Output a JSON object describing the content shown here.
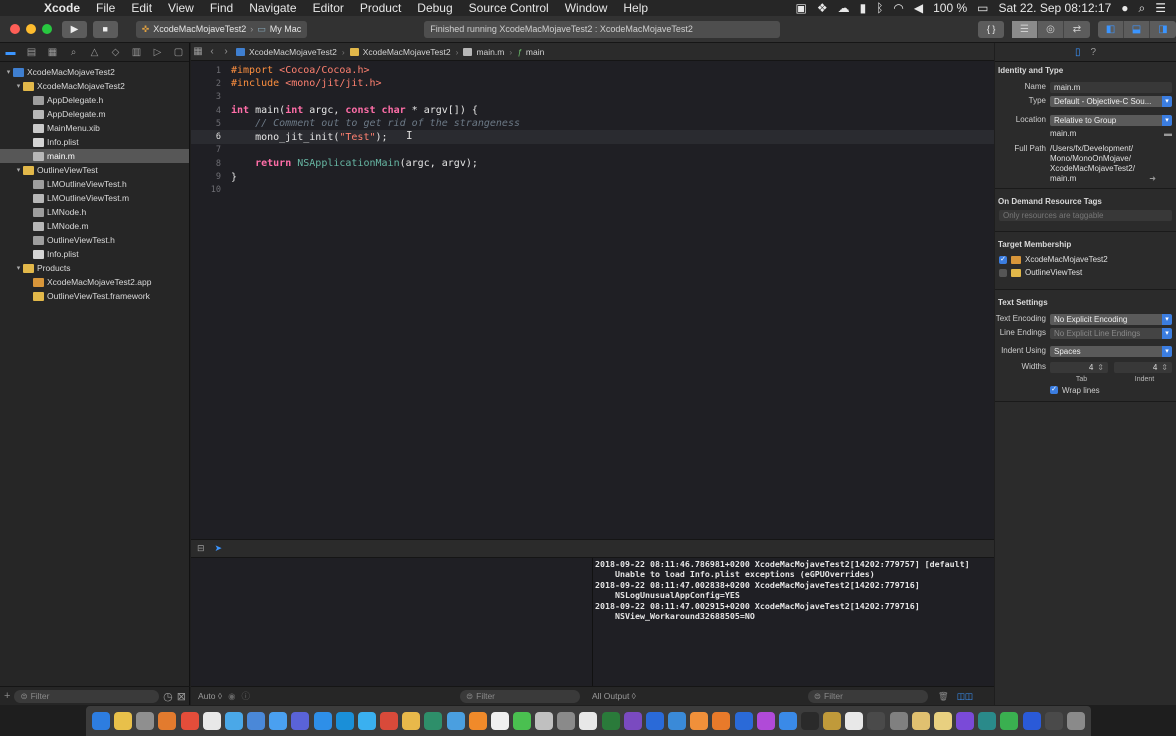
{
  "menubar": {
    "app_name": "Xcode",
    "menus": [
      "File",
      "Edit",
      "View",
      "Find",
      "Navigate",
      "Editor",
      "Product",
      "Debug",
      "Source Control",
      "Window",
      "Help"
    ],
    "battery": "100 %",
    "clock": "Sat 22. Sep  08:12:17"
  },
  "toolbar": {
    "scheme": "XcodeMacMojaveTest2",
    "destination": "My Mac",
    "activity": "Finished running XcodeMacMojaveTest2 : XcodeMacMojaveTest2",
    "code_review_label": "{ }"
  },
  "navigator": {
    "items": [
      {
        "label": "XcodeMacMojaveTest2",
        "depth": 0,
        "kind": "proj",
        "disclosure": "▾",
        "selected": false
      },
      {
        "label": "XcodeMacMojaveTest2",
        "depth": 1,
        "kind": "folder",
        "disclosure": "▾",
        "selected": false
      },
      {
        "label": "AppDelegate.h",
        "depth": 2,
        "kind": "h",
        "disclosure": "",
        "selected": false
      },
      {
        "label": "AppDelegate.m",
        "depth": 2,
        "kind": "m",
        "disclosure": "",
        "selected": false
      },
      {
        "label": "MainMenu.xib",
        "depth": 2,
        "kind": "xib",
        "disclosure": "",
        "selected": false
      },
      {
        "label": "Info.plist",
        "depth": 2,
        "kind": "plist",
        "disclosure": "",
        "selected": false
      },
      {
        "label": "main.m",
        "depth": 2,
        "kind": "m",
        "disclosure": "",
        "selected": true
      },
      {
        "label": "OutlineViewTest",
        "depth": 1,
        "kind": "folder",
        "disclosure": "▾",
        "selected": false
      },
      {
        "label": "LMOutlineViewTest.h",
        "depth": 2,
        "kind": "h",
        "disclosure": "",
        "selected": false
      },
      {
        "label": "LMOutlineViewTest.m",
        "depth": 2,
        "kind": "m",
        "disclosure": "",
        "selected": false
      },
      {
        "label": "LMNode.h",
        "depth": 2,
        "kind": "h",
        "disclosure": "",
        "selected": false
      },
      {
        "label": "LMNode.m",
        "depth": 2,
        "kind": "m",
        "disclosure": "",
        "selected": false
      },
      {
        "label": "OutlineViewTest.h",
        "depth": 2,
        "kind": "h",
        "disclosure": "",
        "selected": false
      },
      {
        "label": "Info.plist",
        "depth": 2,
        "kind": "plist",
        "disclosure": "",
        "selected": false
      },
      {
        "label": "Products",
        "depth": 1,
        "kind": "folder",
        "disclosure": "▾",
        "selected": false
      },
      {
        "label": "XcodeMacMojaveTest2.app",
        "depth": 2,
        "kind": "app",
        "disclosure": "",
        "selected": false
      },
      {
        "label": "OutlineViewTest.framework",
        "depth": 2,
        "kind": "fw",
        "disclosure": "",
        "selected": false
      }
    ],
    "filter_placeholder": "Filter"
  },
  "jumpbar": {
    "crumbs": [
      "XcodeMacMojaveTest2",
      "XcodeMacMojaveTest2",
      "main.m",
      "main"
    ]
  },
  "editor": {
    "current_line": 6,
    "lines": [
      [
        {
          "t": "#import ",
          "c": "pp"
        },
        {
          "t": "<Cocoa/Cocoa.h>",
          "c": "inc"
        }
      ],
      [
        {
          "t": "#include ",
          "c": "pp"
        },
        {
          "t": "<mono/jit/jit.h>",
          "c": "inc"
        }
      ],
      [],
      [
        {
          "t": "int",
          "c": "kw"
        },
        {
          "t": " main(",
          "c": ""
        },
        {
          "t": "int",
          "c": "kw"
        },
        {
          "t": " argc, ",
          "c": ""
        },
        {
          "t": "const",
          "c": "kw"
        },
        {
          "t": " ",
          "c": ""
        },
        {
          "t": "char",
          "c": "kw"
        },
        {
          "t": " * argv[]) {",
          "c": ""
        }
      ],
      [
        {
          "t": "    // Comment out to get rid of the strangeness",
          "c": "cm"
        }
      ],
      [
        {
          "t": "    mono_jit_init(",
          "c": ""
        },
        {
          "t": "\"Test\"",
          "c": "str"
        },
        {
          "t": ");",
          "c": ""
        }
      ],
      [],
      [
        {
          "t": "    ",
          "c": ""
        },
        {
          "t": "return",
          "c": "kw"
        },
        {
          "t": " ",
          "c": ""
        },
        {
          "t": "NSApplicationMain",
          "c": "fn"
        },
        {
          "t": "(argc, argv);",
          "c": ""
        }
      ],
      [
        {
          "t": "}",
          "c": ""
        }
      ],
      []
    ]
  },
  "console": {
    "lines": [
      "2018-09-22 08:11:46.786981+0200 XcodeMacMojaveTest2[14202:779757] [default]",
      "    Unable to load Info.plist exceptions (eGPUOverrides)",
      "2018-09-22 08:11:47.002838+0200 XcodeMacMojaveTest2[14202:779716]",
      "    NSLogUnusualAppConfig=YES",
      "2018-09-22 08:11:47.002915+0200 XcodeMacMojaveTest2[14202:779716]",
      "    NSView_Workaround32688505=NO"
    ]
  },
  "debug_footer": {
    "auto_label": "Auto ◊",
    "filter_placeholder": "Filter",
    "output_label": "All Output ◊",
    "console_filter_placeholder": "Filter"
  },
  "inspector": {
    "identity_title": "Identity and Type",
    "name_label": "Name",
    "name_value": "main.m",
    "type_label": "Type",
    "type_value": "Default - Objective-C Sou...",
    "location_label": "Location",
    "location_value": "Relative to Group",
    "location_file": "main.m",
    "fullpath_label": "Full Path",
    "fullpath_lines": [
      "/Users/fx/Development/",
      "Mono/MonoOnMojave/",
      "XcodeMacMojaveTest2/",
      "main.m"
    ],
    "ondemand_title": "On Demand Resource Tags",
    "ondemand_placeholder": "Only resources are taggable",
    "target_title": "Target Membership",
    "targets": [
      {
        "label": "XcodeMacMojaveTest2",
        "checked": true
      },
      {
        "label": "OutlineViewTest",
        "checked": false
      }
    ],
    "text_title": "Text Settings",
    "encoding_label": "Text Encoding",
    "encoding_value": "No Explicit Encoding",
    "endings_label": "Line Endings",
    "endings_value": "No Explicit Line Endings",
    "indent_label": "Indent Using",
    "indent_value": "Spaces",
    "widths_label": "Widths",
    "tab_value": "4",
    "indent_width_value": "4",
    "tab_caption": "Tab",
    "indent_caption": "Indent",
    "wrap_label": "Wrap lines"
  },
  "colors": {
    "accent": "#3b95ff",
    "close": "#ff5f57",
    "minimize": "#febc2e",
    "zoom": "#28c840"
  },
  "dock": {
    "icon_colors": [
      "#2d7de0",
      "#e8c04a",
      "#8f8f8f",
      "#e37b2e",
      "#e44d3a",
      "#e8e8e8",
      "#4aa8e8",
      "#4a88d8",
      "#4aa0f0",
      "#5a63d8",
      "#2e8fe8",
      "#1a8fd8",
      "#3ab0f0",
      "#d84a3a",
      "#e8b84a",
      "#2e8f6a",
      "#4a9fe0",
      "#f08a2a",
      "#f0f0f0",
      "#4ac050",
      "#c0c0c0",
      "#8a8a8a",
      "#e8e8e8",
      "#2a7a3a",
      "#7a4ac0",
      "#2a6ad8",
      "#3a8ad8",
      "#f0903a",
      "#e87a2a",
      "#2a6ad8",
      "#b04ad8",
      "#3a8ae8",
      "#2a2a2a",
      "#c09a3a",
      "#e8e8e8",
      "#4a4a4a",
      "#808080",
      "#e0c070",
      "#e8d080",
      "#7a4ad8",
      "#2a8a8a",
      "#3ab050",
      "#2a5ad8",
      "#4a4a4a",
      "#8a8a8a"
    ]
  }
}
